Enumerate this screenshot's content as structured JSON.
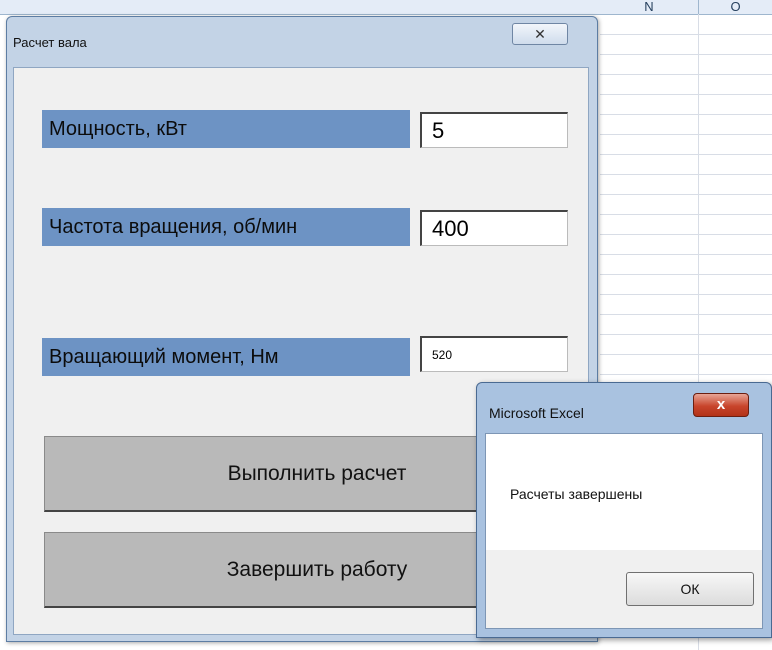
{
  "sheet": {
    "columns": [
      "N",
      "O"
    ]
  },
  "userform": {
    "title": "Расчет вала",
    "close_glyph": "✕",
    "close_icon": "close-icon",
    "fields": [
      {
        "label": "Мощность, кВт",
        "value": "5"
      },
      {
        "label": "Частота вращения, об/мин",
        "value": "400"
      },
      {
        "label": "Вращающий момент, Нм",
        "value": "520"
      }
    ],
    "buttons": {
      "calculate": "Выполнить расчет",
      "finish": "Завершить работу"
    }
  },
  "msgbox": {
    "title": "Microsoft Excel",
    "close_glyph": "x",
    "close_icon": "close-icon",
    "message": "Расчеты завершены",
    "ok_label": "ОК"
  },
  "colors": {
    "label_background": "#6d93c4",
    "button_background": "#b9b9b9",
    "close_button_red": "#c8452c",
    "window_frame": "#c3d3e6"
  }
}
